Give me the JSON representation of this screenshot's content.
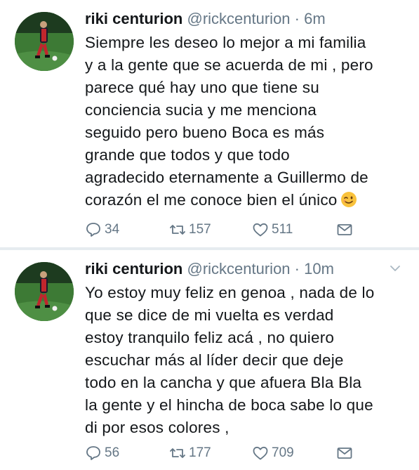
{
  "tweets": [
    {
      "author_name": "riki centurion",
      "handle": "@rickcenturion",
      "separator": "·",
      "time": "6m",
      "lines": [
        "Siempre les deseo lo mejor a mi familia",
        "y a la gente que se acuerda de mi , pero",
        "parece qué hay uno que tiene su",
        "conciencia sucia y me menciona",
        "seguido pero bueno Boca es más",
        "grande que todos y que todo",
        "agradecido eternamente a Guillermo de",
        "corazón el me conoce bien el único"
      ],
      "emoji": "winking-face",
      "replies": "34",
      "retweets": "157",
      "likes": "511"
    },
    {
      "author_name": "riki centurion",
      "handle": "@rickcenturion",
      "separator": "·",
      "time": "10m",
      "lines": [
        "Yo estoy muy feliz en genoa , nada de lo",
        "que se dice de mi vuelta es verdad",
        "estoy tranquilo feliz acá , no quiero",
        "escuchar más al líder decir que deje",
        "todo en la cancha y que afuera Bla Bla",
        "la gente y el hincha de boca sabe lo que",
        "di por esos colores ,"
      ],
      "replies": "56",
      "retweets": "177",
      "likes": "709"
    }
  ],
  "colors": {
    "text": "#14171a",
    "muted": "#657786",
    "divider": "#e6ecf0"
  },
  "icons": [
    "reply-icon",
    "retweet-icon",
    "like-icon",
    "direct-message-icon",
    "caret-down-icon"
  ]
}
